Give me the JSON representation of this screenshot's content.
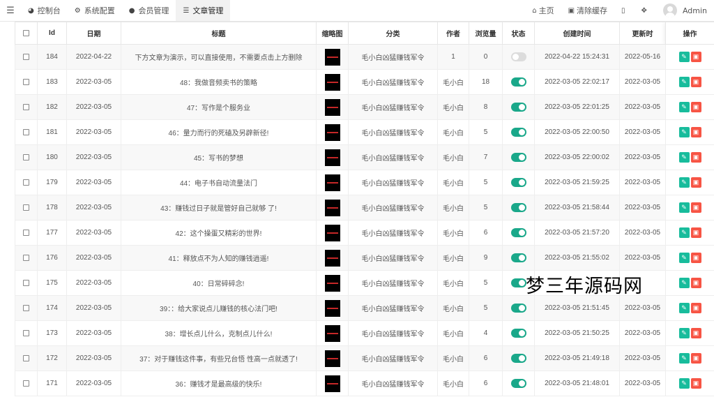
{
  "topnav": {
    "items": [
      {
        "icon": "dashboard-icon",
        "label": "控制台"
      },
      {
        "icon": "gear-icon",
        "label": "系统配置"
      },
      {
        "icon": "user-icon",
        "label": "会员管理"
      },
      {
        "icon": "list-icon",
        "label": "文章管理"
      }
    ],
    "home_label": "主页",
    "clear_cache_label": "清除缓存",
    "user_name": "Admin"
  },
  "table": {
    "headers": {
      "id": "Id",
      "date": "日期",
      "title": "标题",
      "thumb": "缩略图",
      "category": "分类",
      "author": "作者",
      "views": "浏览量",
      "status": "状态",
      "created": "创建时间",
      "updated": "更新时",
      "ops": "操作"
    },
    "rows": [
      {
        "id": "184",
        "date": "2022-04-22",
        "title": "下方文章为演示，可以直接使用，不需要点击上方删除",
        "category": "毛小白凶猛赚钱军令",
        "author": "1",
        "views": "0",
        "status": false,
        "created": "2022-04-22 15:24:31",
        "updated": "2022-05-16"
      },
      {
        "id": "183",
        "date": "2022-03-05",
        "title": "48：我做音频卖书的策略",
        "category": "毛小白凶猛赚钱军令",
        "author": "毛小白",
        "views": "18",
        "status": true,
        "created": "2022-03-05 22:02:17",
        "updated": "2022-03-05"
      },
      {
        "id": "182",
        "date": "2022-03-05",
        "title": "47：写作是个服务业",
        "category": "毛小白凶猛赚钱军令",
        "author": "毛小白",
        "views": "8",
        "status": true,
        "created": "2022-03-05 22:01:25",
        "updated": "2022-03-05"
      },
      {
        "id": "181",
        "date": "2022-03-05",
        "title": "46：量力而行的死磕及另辟新径!",
        "category": "毛小白凶猛赚钱军令",
        "author": "毛小白",
        "views": "5",
        "status": true,
        "created": "2022-03-05 22:00:50",
        "updated": "2022-03-05"
      },
      {
        "id": "180",
        "date": "2022-03-05",
        "title": "45：写书的梦想",
        "category": "毛小白凶猛赚钱军令",
        "author": "毛小白",
        "views": "7",
        "status": true,
        "created": "2022-03-05 22:00:02",
        "updated": "2022-03-05"
      },
      {
        "id": "179",
        "date": "2022-03-05",
        "title": "44：电子书自动流量法门",
        "category": "毛小白凶猛赚钱军令",
        "author": "毛小白",
        "views": "5",
        "status": true,
        "created": "2022-03-05 21:59:25",
        "updated": "2022-03-05"
      },
      {
        "id": "178",
        "date": "2022-03-05",
        "title": "43：赚钱过日子就是管好自己就够 了!",
        "category": "毛小白凶猛赚钱军令",
        "author": "毛小白",
        "views": "5",
        "status": true,
        "created": "2022-03-05 21:58:44",
        "updated": "2022-03-05"
      },
      {
        "id": "177",
        "date": "2022-03-05",
        "title": "42：这个操蛋又精彩的世界!",
        "category": "毛小白凶猛赚钱军令",
        "author": "毛小白",
        "views": "6",
        "status": true,
        "created": "2022-03-05 21:57:20",
        "updated": "2022-03-05"
      },
      {
        "id": "176",
        "date": "2022-03-05",
        "title": "41：释放点不为人知的赚钱逍遥!",
        "category": "毛小白凶猛赚钱军令",
        "author": "毛小白",
        "views": "9",
        "status": true,
        "created": "2022-03-05 21:55:02",
        "updated": "2022-03-05"
      },
      {
        "id": "175",
        "date": "2022-03-05",
        "title": "40：日常碎碎念!",
        "category": "毛小白凶猛赚钱军令",
        "author": "毛小白",
        "views": "5",
        "status": true,
        "created": "",
        "updated": ""
      },
      {
        "id": "174",
        "date": "2022-03-05",
        "title": "39：：给大家说点儿赚钱的核心法门吧!",
        "category": "毛小白凶猛赚钱军令",
        "author": "毛小白",
        "views": "5",
        "status": true,
        "created": "2022-03-05 21:51:45",
        "updated": "2022-03-05"
      },
      {
        "id": "173",
        "date": "2022-03-05",
        "title": "38：增长点儿什么，克制点儿什么!",
        "category": "毛小白凶猛赚钱军令",
        "author": "毛小白",
        "views": "4",
        "status": true,
        "created": "2022-03-05 21:50:25",
        "updated": "2022-03-05"
      },
      {
        "id": "172",
        "date": "2022-03-05",
        "title": "37：对于赚钱这件事，有些兄台悟 性高一点就透了!",
        "category": "毛小白凶猛赚钱军令",
        "author": "毛小白",
        "views": "6",
        "status": true,
        "created": "2022-03-05 21:49:18",
        "updated": "2022-03-05"
      },
      {
        "id": "171",
        "date": "2022-03-05",
        "title": "36：赚钱才是最高级的快乐!",
        "category": "毛小白凶猛赚钱军令",
        "author": "毛小白",
        "views": "6",
        "status": true,
        "created": "2022-03-05 21:48:01",
        "updated": "2022-03-05"
      }
    ]
  },
  "watermark": "梦三年源码网"
}
